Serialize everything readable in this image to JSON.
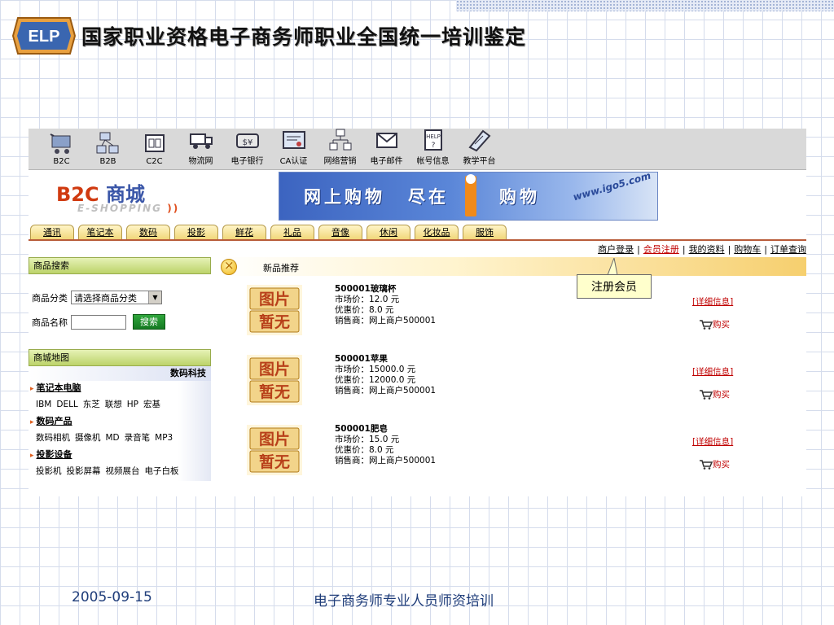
{
  "slide": {
    "logo_text": "ELP",
    "title": "国家职业资格电子商务师职业全国统一培训鉴定",
    "footer_date": "2005-09-15",
    "footer_center": "电子商务师专业人员师资培训",
    "callout": "注册会员"
  },
  "toolbar": [
    {
      "label": "B2C",
      "icon": "shopping-cart-icon"
    },
    {
      "label": "B2B",
      "icon": "network-icon"
    },
    {
      "label": "C2C",
      "icon": "c2c-icon"
    },
    {
      "label": "物流网",
      "icon": "truck-icon"
    },
    {
      "label": "电子银行",
      "icon": "bank-icon"
    },
    {
      "label": "CA认证",
      "icon": "certificate-icon"
    },
    {
      "label": "网络营销",
      "icon": "marketing-icon"
    },
    {
      "label": "电子邮件",
      "icon": "email-icon"
    },
    {
      "label": "帐号信息",
      "icon": "help-icon"
    },
    {
      "label": "教学平台",
      "icon": "teaching-icon"
    }
  ],
  "store": {
    "logo_b2c": "B2C",
    "logo_cn": "商城",
    "logo_en": "E-SHOPPING",
    "banner_text1": "网上购物",
    "banner_text2": "尽在",
    "banner_text3": "购物",
    "banner_url": "www.igo5.com"
  },
  "categories": [
    "通讯",
    "笔记本",
    "数码",
    "投影",
    "鲜花",
    "礼品",
    "音像",
    "休闲",
    "化妆品",
    "服饰"
  ],
  "user_links": {
    "merchant_login": "商户登录",
    "member_register": "会员注册",
    "my_profile": "我的资料",
    "cart": "购物车",
    "order_query": "订单查询"
  },
  "search": {
    "header": "商品搜索",
    "category_label": "商品分类",
    "category_value": "请选择商品分类",
    "name_label": "商品名称",
    "name_value": "",
    "button": "搜索"
  },
  "map": {
    "header": "商城地图",
    "subheader": "数码科技",
    "sections": [
      {
        "title": "笔记本电脑",
        "items": [
          "IBM",
          "DELL",
          "东芝",
          "联想",
          "HP",
          "宏基"
        ]
      },
      {
        "title": "数码产品",
        "items": [
          "数码相机",
          "摄像机",
          "MD",
          "录音笔",
          "MP3"
        ]
      },
      {
        "title": "投影设备",
        "items": [
          "投影机",
          "投影屏幕",
          "视频展台",
          "电子白板"
        ]
      }
    ]
  },
  "products": {
    "header": "新品推荐",
    "thumb_text1": "图片",
    "thumb_text2": "暂无",
    "detail_label": "[详细信息]",
    "buy_label": "购买",
    "items": [
      {
        "name": "500001玻璃杯",
        "market": "市场价：12.0 元",
        "discount": "优惠价：8.0 元",
        "seller": "销售商：网上商户500001"
      },
      {
        "name": "500001苹果",
        "market": "市场价：15000.0 元",
        "discount": "优惠价：12000.0 元",
        "seller": "销售商：网上商户500001"
      },
      {
        "name": "500001肥皂",
        "market": "市场价：15.0 元",
        "discount": "优惠价：8.0 元",
        "seller": "销售商：网上商户500001"
      }
    ]
  }
}
